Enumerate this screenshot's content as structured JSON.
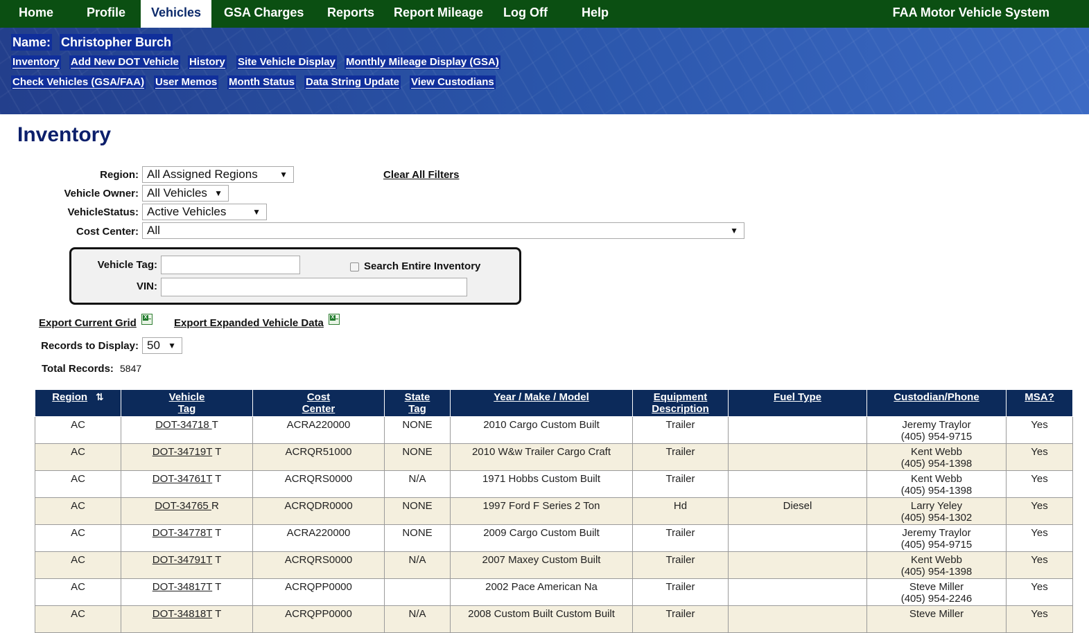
{
  "nav": {
    "items": [
      "Home",
      "Profile",
      "Vehicles",
      "GSA Charges",
      "Reports",
      "Report Mileage",
      "Log Off",
      "Help"
    ],
    "active": "Vehicles",
    "system_title": "FAA Motor Vehicle System"
  },
  "user": {
    "name_label": "Name:",
    "name": "Christopher Burch"
  },
  "subnav": {
    "row1": [
      "Inventory",
      "Add New DOT Vehicle",
      "History",
      "Site Vehicle Display",
      "Monthly Mileage Display (GSA)"
    ],
    "row2": [
      "Check Vehicles (GSA/FAA)",
      "User Memos",
      "Month Status",
      "Data String Update",
      "View Custodians"
    ]
  },
  "page": {
    "title": "Inventory"
  },
  "filters": {
    "region_label": "Region:",
    "region_value": "All Assigned Regions",
    "owner_label": "Vehicle Owner:",
    "owner_value": "All Vehicles",
    "status_label": "VehicleStatus:",
    "status_value": "Active Vehicles",
    "cost_center_label": "Cost Center:",
    "cost_center_value": "All",
    "clear_all": "Clear All Filters"
  },
  "search": {
    "vehicle_tag_label": "Vehicle Tag:",
    "vehicle_tag_value": "",
    "vin_label": "VIN:",
    "vin_value": "",
    "entire_inventory_label": "Search Entire Inventory",
    "entire_inventory_checked": false
  },
  "export": {
    "current_grid": "Export Current Grid",
    "expanded_data": "Export Expanded Vehicle Data",
    "icon": "excel-icon"
  },
  "records": {
    "display_label": "Records to Display:",
    "display_value": "50",
    "total_label": "Total Records:",
    "total_value": "5847"
  },
  "grid": {
    "columns": [
      {
        "line1": "Region",
        "line2": ""
      },
      {
        "line1": "Vehicle",
        "line2": "Tag"
      },
      {
        "line1": "Cost",
        "line2": "Center"
      },
      {
        "line1": "State",
        "line2": "Tag"
      },
      {
        "line1": "Year / Make / Model",
        "line2": ""
      },
      {
        "line1": "Equipment",
        "line2": "Description"
      },
      {
        "line1": "Fuel Type",
        "line2": ""
      },
      {
        "line1": "Custodian/Phone",
        "line2": ""
      },
      {
        "line1": "MSA?",
        "line2": ""
      }
    ],
    "sort_icon": "sort-az-icon",
    "rows": [
      {
        "region": "AC",
        "tag": "DOT-34718 ",
        "tag_suffix": "T",
        "cost_center": "ACRA220000",
        "state_tag": "NONE",
        "ymm": "2010 Cargo Custom Built",
        "equipment": "Trailer",
        "fuel": "",
        "custodian": "Jeremy Traylor",
        "phone": "(405) 954-9715",
        "msa": "Yes"
      },
      {
        "region": "AC",
        "tag": "DOT-34719T",
        "tag_suffix": "T",
        "cost_center": "ACRQR51000",
        "state_tag": "NONE",
        "ymm": "2010 W&w Trailer Cargo Craft",
        "equipment": "Trailer",
        "fuel": "",
        "custodian": "Kent Webb",
        "phone": "(405) 954-1398",
        "msa": "Yes"
      },
      {
        "region": "AC",
        "tag": "DOT-34761T",
        "tag_suffix": "T",
        "cost_center": "ACRQRS0000",
        "state_tag": "N/A",
        "ymm": "1971 Hobbs Custom Built",
        "equipment": "Trailer",
        "fuel": "",
        "custodian": "Kent Webb",
        "phone": "(405) 954-1398",
        "msa": "Yes"
      },
      {
        "region": "AC",
        "tag": "DOT-34765 ",
        "tag_suffix": "R",
        "cost_center": "ACRQDR0000",
        "state_tag": "NONE",
        "ymm": "1997 Ford F Series 2 Ton",
        "equipment": "Hd",
        "fuel": "Diesel",
        "custodian": "Larry Yeley",
        "phone": "(405) 954-1302",
        "msa": "Yes"
      },
      {
        "region": "AC",
        "tag": "DOT-34778T",
        "tag_suffix": "T",
        "cost_center": "ACRA220000",
        "state_tag": "NONE",
        "ymm": "2009 Cargo Custom Built",
        "equipment": "Trailer",
        "fuel": "",
        "custodian": "Jeremy Traylor",
        "phone": "(405) 954-9715",
        "msa": "Yes"
      },
      {
        "region": "AC",
        "tag": "DOT-34791T",
        "tag_suffix": "T",
        "cost_center": "ACRQRS0000",
        "state_tag": "N/A",
        "ymm": "2007 Maxey Custom Built",
        "equipment": "Trailer",
        "fuel": "",
        "custodian": "Kent Webb",
        "phone": "(405) 954-1398",
        "msa": "Yes"
      },
      {
        "region": "AC",
        "tag": "DOT-34817T",
        "tag_suffix": "T",
        "cost_center": "ACRQPP0000",
        "state_tag": "",
        "ymm": "2002 Pace American Na",
        "equipment": "Trailer",
        "fuel": "",
        "custodian": "Steve Miller",
        "phone": "(405) 954-2246",
        "msa": "Yes"
      },
      {
        "region": "AC",
        "tag": "DOT-34818T",
        "tag_suffix": "T",
        "cost_center": "ACRQPP0000",
        "state_tag": "N/A",
        "ymm": "2008 Custom Built Custom Built",
        "equipment": "Trailer",
        "fuel": "",
        "custodian": "Steve Miller",
        "phone": "",
        "msa": "Yes"
      }
    ]
  }
}
